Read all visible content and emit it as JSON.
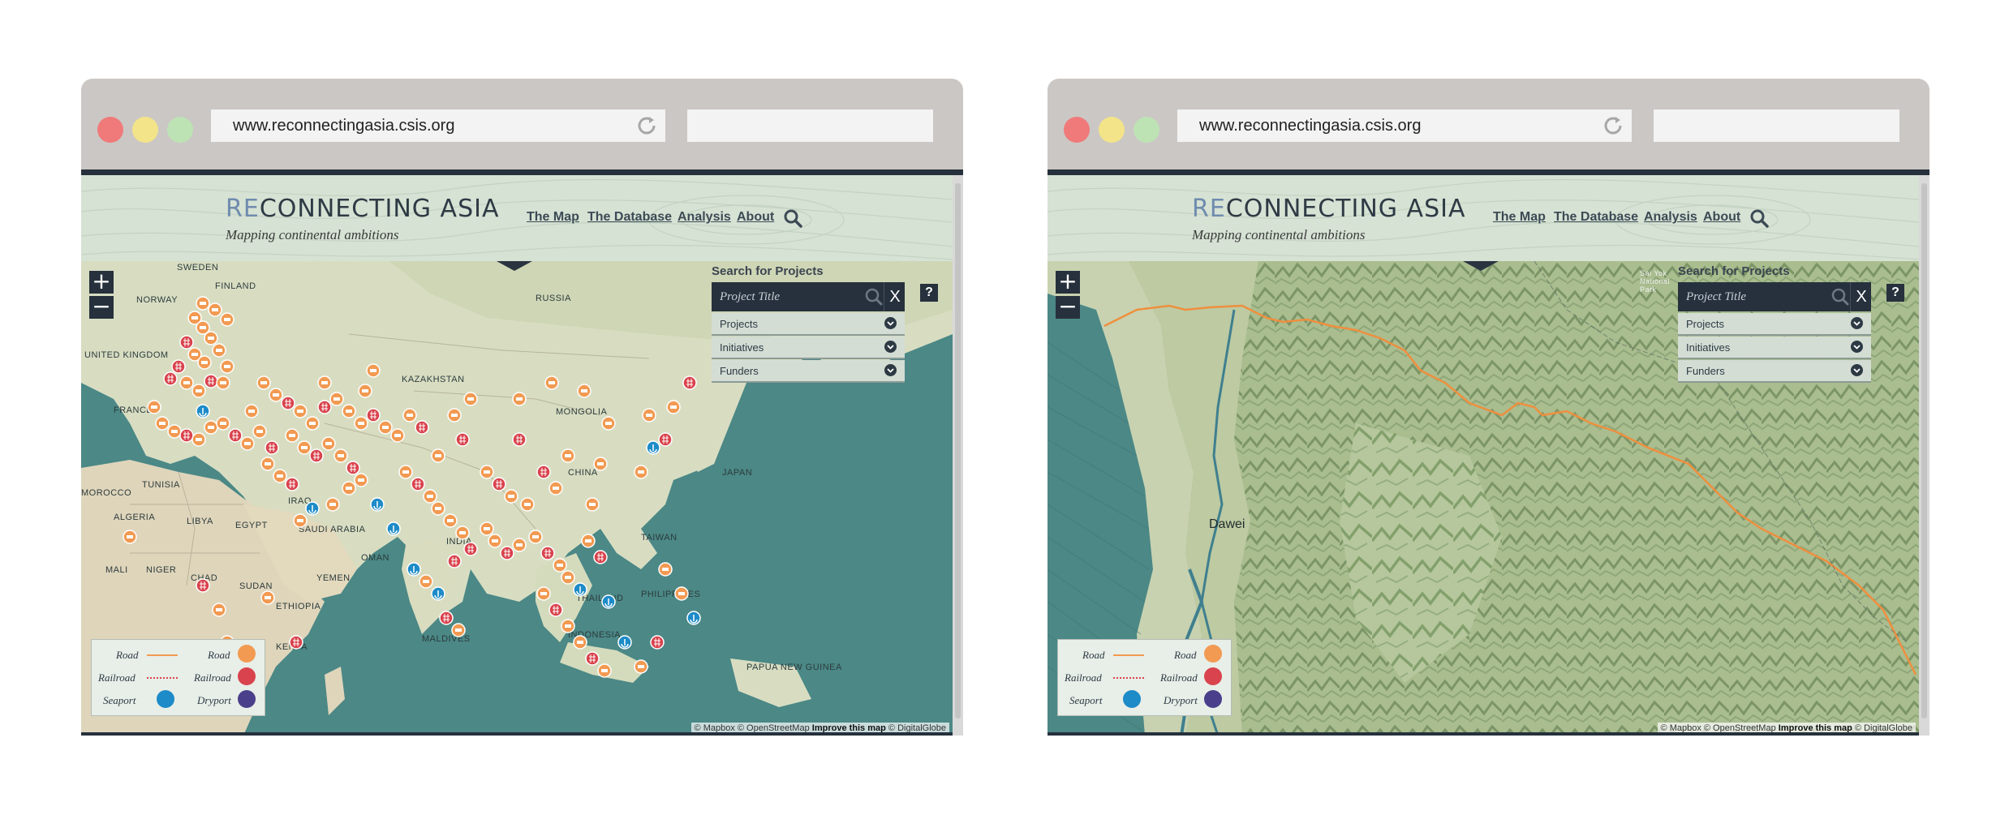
{
  "browser": {
    "url": "www.reconnectingasia.csis.org",
    "colors": {
      "close": "#f07a7a",
      "minimize": "#f3e489",
      "maximize": "#bde3b5",
      "chrome": "#cbc7c4"
    }
  },
  "site": {
    "logo_prefix": "RE",
    "logo_rest": "CONNECTING ASIA",
    "tagline": "Mapping continental ambitions",
    "nav": [
      "The Map",
      "The Database",
      "Analysis",
      "About"
    ],
    "search_icon": "magnifier-icon"
  },
  "search_panel": {
    "title": "Search for Projects",
    "placeholder": "Project Title",
    "close": "X",
    "help": "?",
    "filters": [
      "Projects",
      "Initiatives",
      "Funders"
    ]
  },
  "zoom": {
    "in": "+",
    "out": "−"
  },
  "legend": {
    "rows": [
      {
        "left": "Road",
        "right": "Road",
        "icon": "road-icon",
        "color": "#f29a52"
      },
      {
        "left": "Railroad",
        "right": "Railroad",
        "icon": "railroad-icon",
        "color": "#d9434d"
      },
      {
        "left": "Seaport",
        "right": "Dryport",
        "icon_left": "seaport-icon",
        "icon_right": "dryport-icon",
        "color_left": "#1d8bc8",
        "color_right": "#4a3f8a"
      }
    ]
  },
  "attribution": {
    "text": "© Mapbox © OpenStreetMap",
    "improve": "Improve this map",
    "suffix": "© DigitalGlobe"
  },
  "map1_labels": {
    "countries": [
      "SWEDEN",
      "FINLAND",
      "NORWAY",
      "UNITED KINGDOM",
      "FRANCE",
      "RUSSIA",
      "KAZAKHSTAN",
      "MONGOLIA",
      "CHINA",
      "JAPAN",
      "MOROCCO",
      "ALGERIA",
      "TUNISIA",
      "LIBYA",
      "EGYPT",
      "MALI",
      "NIGER",
      "CHAD",
      "SUDAN",
      "SAUDI ARABIA",
      "IRAQ",
      "OMAN",
      "YEMEN",
      "ETHIOPIA",
      "KENYA",
      "INDIA",
      "TAIWAN",
      "PHILIPPINES",
      "MALDIVES",
      "PAPUA NEW GUINEA",
      "INDONESIA",
      "THAILAND"
    ]
  },
  "map2_labels": {
    "city": "Dawei",
    "park": "Sai Yok National Park"
  }
}
